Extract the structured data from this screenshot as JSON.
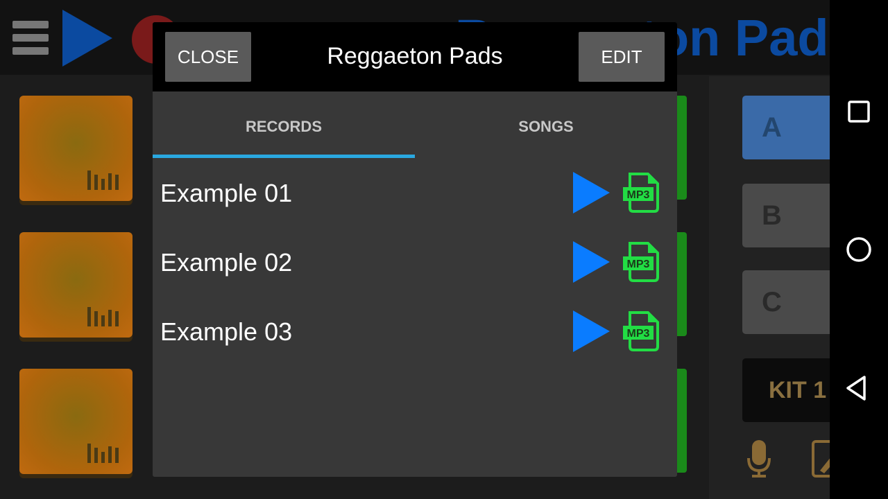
{
  "app": {
    "title": "Reggaeton Pads",
    "kit_buttons": [
      "A",
      "B",
      "C",
      "KIT 1"
    ]
  },
  "dialog": {
    "title": "Reggaeton Pads",
    "close_label": "CLOSE",
    "edit_label": "EDIT",
    "tabs": [
      {
        "label": "RECORDS",
        "active": true
      },
      {
        "label": "SONGS",
        "active": false
      }
    ],
    "records": [
      {
        "name": "Example 01"
      },
      {
        "name": "Example 02"
      },
      {
        "name": "Example 03"
      }
    ],
    "mp3_label": "MP3"
  },
  "colors": {
    "accent": "#2aa8e0",
    "play": "#0a7cff",
    "mp3": "#22dd44"
  },
  "nav": {
    "icons": [
      "recents-icon",
      "home-icon",
      "back-icon"
    ]
  }
}
